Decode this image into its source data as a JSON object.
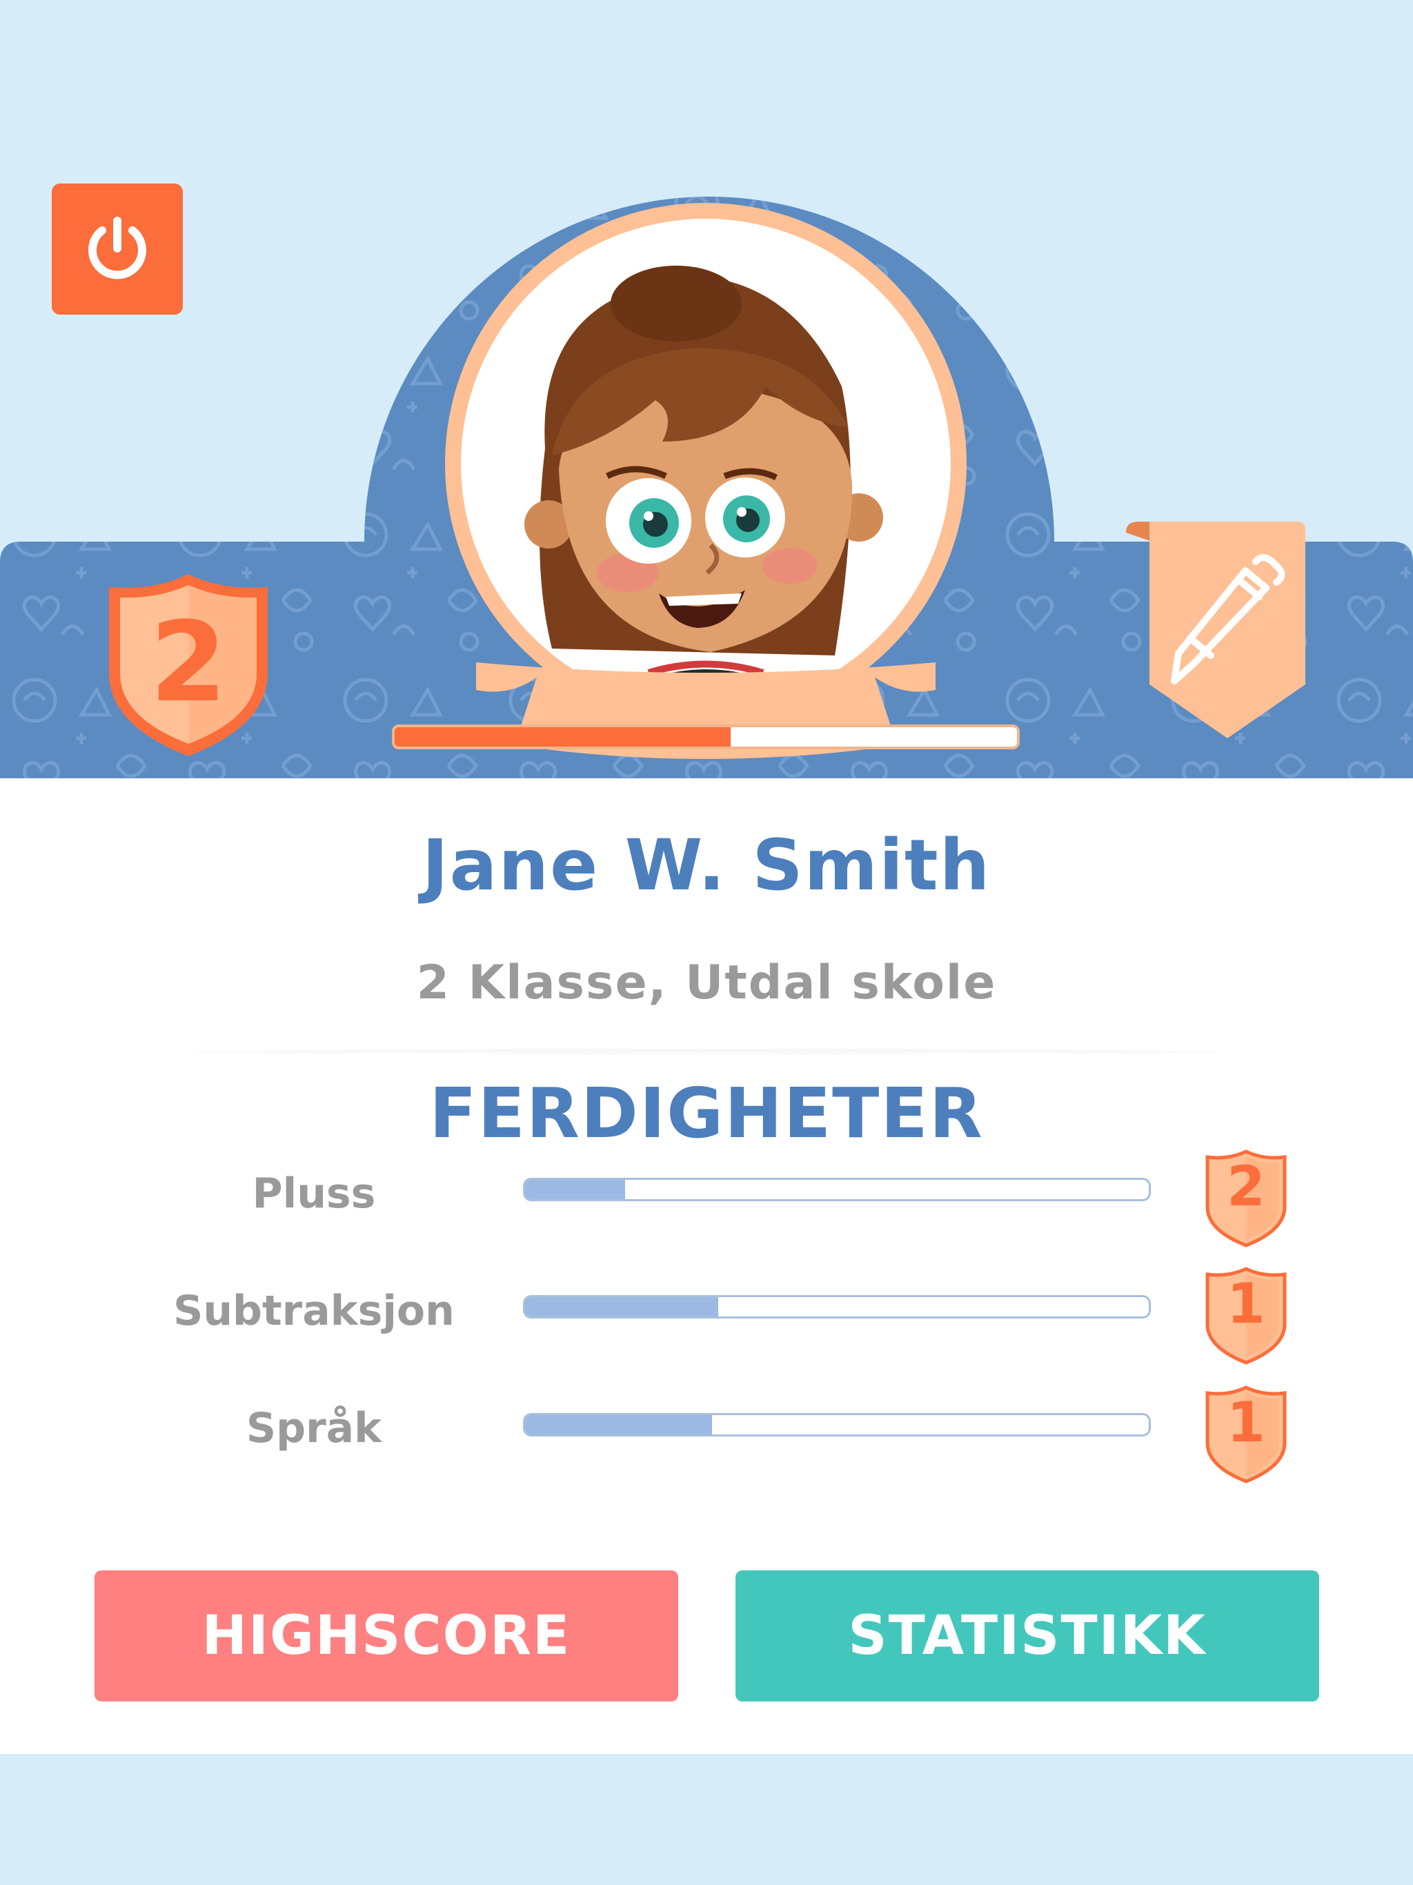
{
  "profile": {
    "name": "Jane W. Smith",
    "subtitle": "2 Klasse, Utdal skole",
    "level": "2",
    "level_progress": 0.54
  },
  "skills": {
    "title": "FERDIGHETER",
    "items": [
      {
        "label": "Pluss",
        "level": "2",
        "progress": 0.16
      },
      {
        "label": "Subtraksjon",
        "level": "1",
        "progress": 0.31
      },
      {
        "label": "Språk",
        "level": "1",
        "progress": 0.3
      }
    ]
  },
  "buttons": {
    "highscore": "HIGHSCORE",
    "statistikk": "STATISTIKK"
  },
  "icons": {
    "power": "power-icon",
    "edit": "pencil-icon",
    "level_badge": "shield-icon"
  },
  "colors": {
    "background": "#d6ecf9",
    "header_blue": "#5b8bc1",
    "accent_orange": "#fb6d3a",
    "peach": "#fec094",
    "text_blue": "#4d7fbd",
    "highscore": "#fe8080",
    "statistikk": "#43c7bc"
  }
}
